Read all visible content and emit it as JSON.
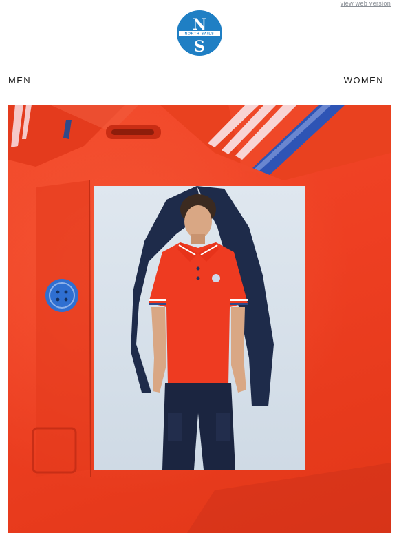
{
  "header": {
    "web_version_label": "view web version",
    "logo_letters": {
      "top": "N",
      "bottom": "S"
    },
    "logo_ring_text": "NORTH SAILS"
  },
  "nav": {
    "men_label": "MEN",
    "women_label": "WOMEN"
  },
  "hero": {
    "background": "red pique polo close-up",
    "inset_photo": "boy wearing red polo shirt and navy cargo pants with navy jacket over shoulder"
  },
  "colors": {
    "brand_blue": "#1f7fc4",
    "polo_red": "#ee3f22",
    "navy": "#1d2a45"
  }
}
